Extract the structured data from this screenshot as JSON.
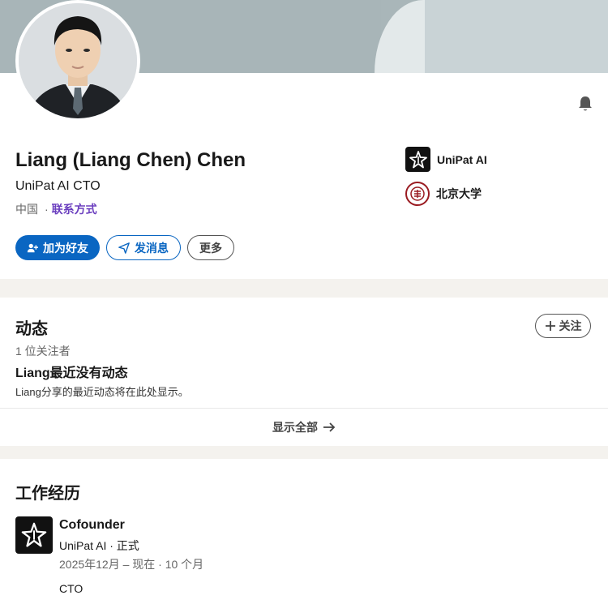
{
  "profile": {
    "name": "Liang (Liang Chen) Chen",
    "headline": "UniPat AI CTO",
    "location": "中国",
    "location_separator": "·",
    "contact_label": "联系方式",
    "organizations": [
      {
        "name": "UniPat AI",
        "icon": "unipat-logo-icon"
      },
      {
        "name": "北京大学",
        "icon": "pku-seal-icon"
      }
    ],
    "buttons": {
      "connect": "加为好友",
      "message": "发消息",
      "more": "更多"
    },
    "notification_icon": "bell-icon"
  },
  "activity": {
    "title": "动态",
    "follow_label": "关注",
    "followers": "1 位关注者",
    "empty_title": "Liang最近没有动态",
    "empty_desc": "Liang分享的最近动态将在此处显示。",
    "show_all": "显示全部"
  },
  "experience": {
    "title": "工作经历",
    "items": [
      {
        "role": "Cofounder",
        "company": "UniPat AI · 正式",
        "dates": "2025年12月 – 现在 · 10 个月",
        "description": "CTO",
        "icon": "unipat-logo-icon"
      }
    ]
  },
  "colors": {
    "primary": "#0a66c2",
    "contact_link": "#6b3fbf",
    "page_bg": "#f4f2ee"
  }
}
